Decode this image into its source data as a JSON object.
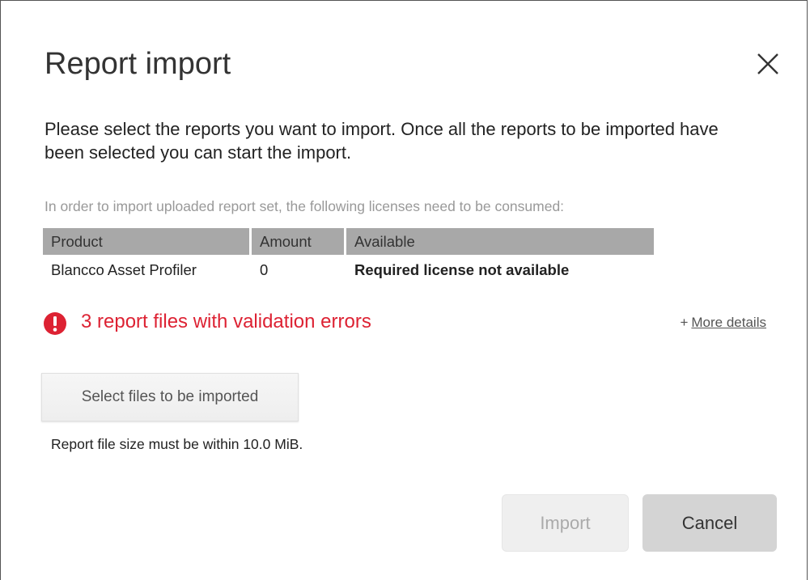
{
  "dialog": {
    "title": "Report import",
    "intro": "Please select the reports you want to import. Once all the reports to be imported have been selected you can start the import.",
    "license_note": "In order to import uploaded report set, the following licenses need to be consumed:"
  },
  "license_table": {
    "headers": {
      "product": "Product",
      "amount": "Amount",
      "available": "Available"
    },
    "rows": [
      {
        "product": "Blancco Asset Profiler",
        "amount": "0",
        "available": "Required license not available"
      }
    ]
  },
  "validation": {
    "error_text": "3 report files with validation errors",
    "more_details_prefix": "+",
    "more_details_label": "More details"
  },
  "upload": {
    "select_files_label": "Select files to be imported",
    "size_note": "Report file size must be within 10.0 MiB."
  },
  "actions": {
    "import_label": "Import",
    "cancel_label": "Cancel"
  },
  "colors": {
    "error": "#dd2233",
    "not_available": "#ee1111",
    "table_header": "#a8a8a8"
  },
  "icons": {
    "close": "close-icon",
    "error": "exclamation-circle-icon"
  }
}
